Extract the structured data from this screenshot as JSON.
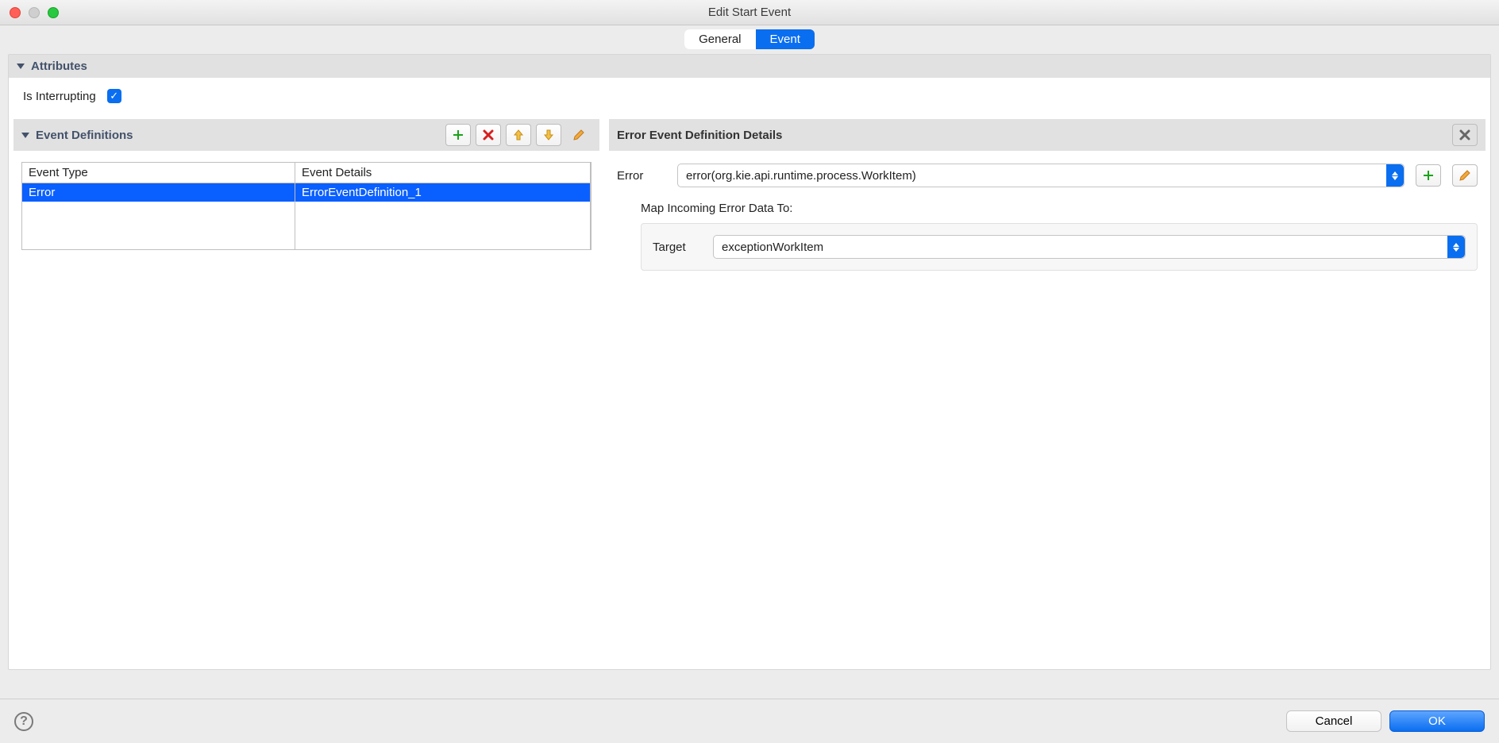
{
  "window": {
    "title": "Edit Start Event"
  },
  "tabs": {
    "general": "General",
    "event": "Event"
  },
  "attributes": {
    "section_title": "Attributes",
    "is_interrupting_label": "Is Interrupting",
    "is_interrupting_checked": true
  },
  "event_definitions": {
    "section_title": "Event Definitions",
    "columns": {
      "type": "Event Type",
      "details": "Event Details"
    },
    "rows": [
      {
        "type": "Error",
        "details": "ErrorEventDefinition_1",
        "selected": true
      }
    ]
  },
  "details": {
    "section_title": "Error Event Definition Details",
    "error_label": "Error",
    "error_value": "error(org.kie.api.runtime.process.WorkItem)",
    "map_label": "Map Incoming Error Data To:",
    "target_label": "Target",
    "target_value": "exceptionWorkItem"
  },
  "footer": {
    "cancel": "Cancel",
    "ok": "OK"
  }
}
